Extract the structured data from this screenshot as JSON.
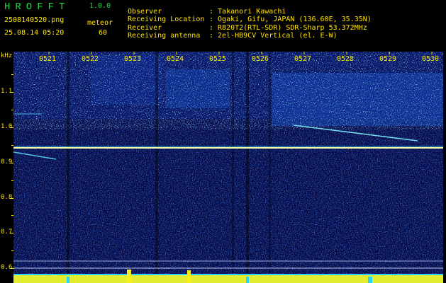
{
  "app": {
    "title": "HROFFT",
    "version": "1.0.0"
  },
  "file": {
    "name": "2508140520.png",
    "timestamp": "25.08.14 05:20"
  },
  "detection": {
    "label": "meteor",
    "count": "60"
  },
  "info": [
    {
      "key": "Observer",
      "value": ": Takanori Kawachi"
    },
    {
      "key": "Receiving Location",
      "value": ": Ogaki, Gifu, JAPAN (136.60E, 35.35N)"
    },
    {
      "key": "Receiver",
      "value": ": R820T2(RTL-SDR) SDR-Sharp 53.372MHz"
    },
    {
      "key": "Receiving antenna",
      "value": ": 2el-HB9CV Vertical (el. E-W)"
    }
  ],
  "axis": {
    "unit": "kHz",
    "y_labels": [
      "1.1",
      "1.0",
      "0.9",
      "0.8",
      "0.7",
      "0.6"
    ],
    "time_labels": [
      "0521",
      "0522",
      "0523",
      "0524",
      "0525",
      "0526",
      "0527",
      "0528",
      "0529",
      "0530"
    ]
  },
  "colors": {
    "text": "#ffe400",
    "title": "#18e03c",
    "background": "#050a45",
    "signal": "#5fe0ff",
    "carrier": "#f4ffb0",
    "meter": "#f7ef1a"
  }
}
